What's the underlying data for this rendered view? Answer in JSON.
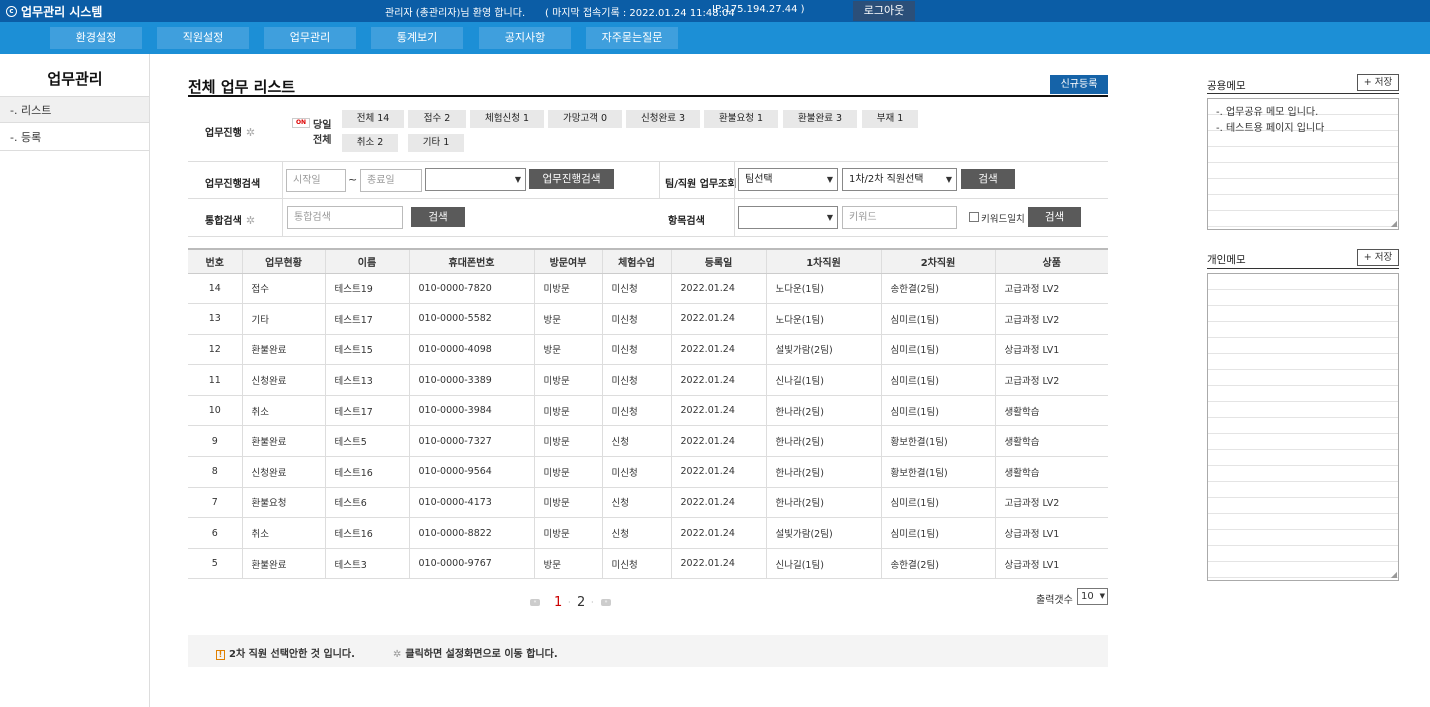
{
  "topbar": {
    "app_title": "업무관리 시스템",
    "welcome": "관리자 (총관리자)님 환영 합니다.",
    "last_login": "( 마지막 접속기록 : 2022.01.24 11:48:04",
    "ip": "IP:175.194.27.44 )",
    "logout_label": "로그아웃"
  },
  "nav": {
    "items": [
      "환경설정",
      "직원설정",
      "업무관리",
      "통계보기",
      "공지사항",
      "자주묻는질문"
    ]
  },
  "sidebar": {
    "title": "업무관리",
    "items": [
      "-. 리스트",
      "-. 등록"
    ]
  },
  "main": {
    "title": "전체 업무 리스트",
    "new_button": "신규등록"
  },
  "search": {
    "progress_label": "업무진행",
    "on_badge": "ON",
    "today_label": "당일",
    "all_label": "전체",
    "chips": [
      "전체 14",
      "접수 2",
      "체험신청 1",
      "가망고객 0",
      "신청완료 3",
      "환불요청 1",
      "환불완료 3",
      "부재 1",
      "취소 2",
      "기타 1"
    ],
    "progress_search_label": "업무진행검색",
    "start_placeholder": "시작일",
    "tilde": "~",
    "end_placeholder": "종료일",
    "progress_search_button": "업무진행검색",
    "team_label": "팀/직원 업무조회",
    "team_select": "팀선택",
    "staff_select": "1차/2차 직원선택",
    "search_button": "검색",
    "integrated_label": "통합검색",
    "integrated_placeholder": "통합검색",
    "item_label": "항목검색",
    "keyword_placeholder": "키워드",
    "keyword_match_label": "키워드일치"
  },
  "table": {
    "headers": [
      "번호",
      "업무현황",
      "이름",
      "휴대폰번호",
      "방문여부",
      "체험수업",
      "등록일",
      "1차직원",
      "2차직원",
      "상품"
    ],
    "rows": [
      [
        "14",
        "접수",
        "테스트19",
        "010-0000-7820",
        "미방문",
        "미신청",
        "2022.01.24",
        "노다운(1팀)",
        "송한결(2팀)",
        "고급과정 LV2"
      ],
      [
        "13",
        "기타",
        "테스트17",
        "010-0000-5582",
        "방문",
        "미신청",
        "2022.01.24",
        "노다운(1팀)",
        "심미르(1팀)",
        "고급과정 LV2"
      ],
      [
        "12",
        "환불완료",
        "테스트15",
        "010-0000-4098",
        "방문",
        "미신청",
        "2022.01.24",
        "설빛가람(2팀)",
        "심미르(1팀)",
        "상급과정 LV1"
      ],
      [
        "11",
        "신청완료",
        "테스트13",
        "010-0000-3389",
        "미방문",
        "미신청",
        "2022.01.24",
        "신나길(1팀)",
        "심미르(1팀)",
        "고급과정 LV2"
      ],
      [
        "10",
        "취소",
        "테스트17",
        "010-0000-3984",
        "미방문",
        "미신청",
        "2022.01.24",
        "한나라(2팀)",
        "심미르(1팀)",
        "생활학습"
      ],
      [
        "9",
        "환불완료",
        "테스트5",
        "010-0000-7327",
        "미방문",
        "신청",
        "2022.01.24",
        "한나라(2팀)",
        "황보한결(1팀)",
        "생활학습"
      ],
      [
        "8",
        "신청완료",
        "테스트16",
        "010-0000-9564",
        "미방문",
        "미신청",
        "2022.01.24",
        "한나라(2팀)",
        "황보한결(1팀)",
        "생활학습"
      ],
      [
        "7",
        "환불요청",
        "테스트6",
        "010-0000-4173",
        "미방문",
        "신청",
        "2022.01.24",
        "한나라(2팀)",
        "심미르(1팀)",
        "고급과정 LV2"
      ],
      [
        "6",
        "취소",
        "테스트16",
        "010-0000-8822",
        "미방문",
        "신청",
        "2022.01.24",
        "설빛가람(2팀)",
        "심미르(1팀)",
        "상급과정 LV1"
      ],
      [
        "5",
        "환불완료",
        "테스트3",
        "010-0000-9767",
        "방문",
        "미신청",
        "2022.01.24",
        "신나길(1팀)",
        "송한결(2팀)",
        "상급과정 LV1"
      ]
    ]
  },
  "pagination": {
    "pages": [
      "1",
      "2"
    ],
    "current": "1",
    "count_label": "출력갯수",
    "count_value": "10"
  },
  "notes": {
    "warn": "2차 직원 선택안한 것 입니다.",
    "gear": "클릭하면 설정화면으로 이동 합니다."
  },
  "memo": {
    "shared_title": "공용메모",
    "shared_lines": [
      "-. 업무공유 메모 입니다.",
      "-. 테스트용 페이지 입니다"
    ],
    "personal_title": "개인메모",
    "save_label": "+ 저장"
  },
  "colors": {
    "topbar": "#0b5da6",
    "navbar": "#1c8fd6",
    "primary_button": "#1563a8",
    "gray_button": "#5a5a5a"
  }
}
